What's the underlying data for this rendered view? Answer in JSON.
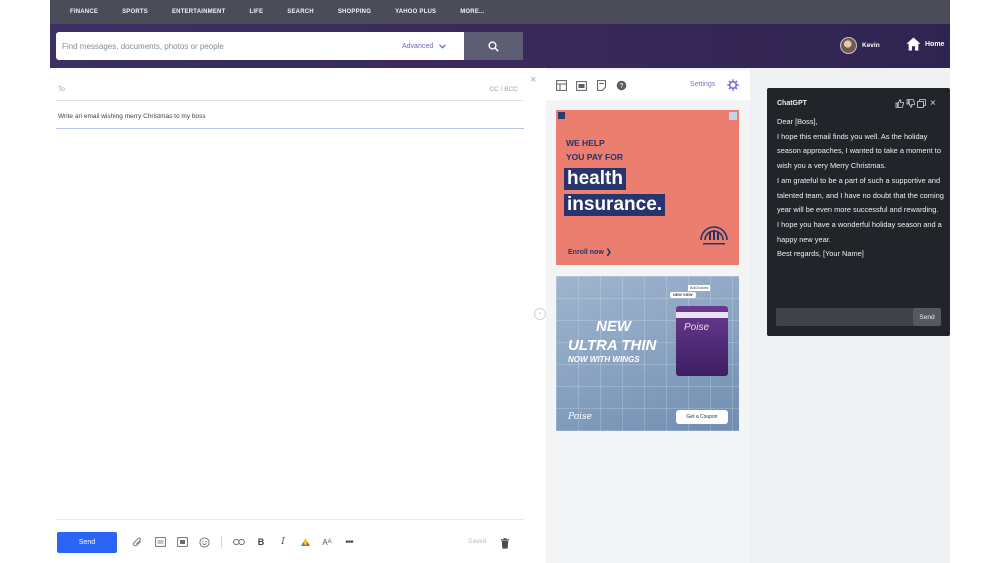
{
  "topnav": {
    "items": [
      "FINANCE",
      "SPORTS",
      "ENTERTAINMENT",
      "LIFE",
      "SEARCH",
      "SHOPPING",
      "YAHOO PLUS",
      "MORE..."
    ]
  },
  "header": {
    "search_placeholder": "Find messages, documents, photos or people",
    "advanced_label": "Advanced",
    "profile_name": "Kevin",
    "home_label": "Home"
  },
  "compose": {
    "to_label": "To",
    "cc_bcc_label": "CC / BCC",
    "subject": "Write an email wishing merry Christmas to my boss",
    "send_label": "Send",
    "saved_label": "Saved"
  },
  "right_panel": {
    "settings_label": "Settings"
  },
  "ad1": {
    "line1": "WE HELP",
    "line2": "YOU PAY FOR",
    "big1": "health",
    "big2": "insurance.",
    "cta": "Enroll now ❯"
  },
  "ad2": {
    "new_badge": "NEW VIEW",
    "adchoices": "AdChoices",
    "headline1": "NEW",
    "headline2": "ULTRA THIN",
    "headline3": "NOW WITH WINGS",
    "pack_brand": "Poise",
    "brand_name": "Poise",
    "coupon_label": "Get a Coupon"
  },
  "chat": {
    "title": "ChatGPT",
    "lines": [
      "Dear [Boss],",
      "I hope this email finds you well. As the holiday season approaches, I wanted to take a moment to wish you a very Merry Christmas.",
      "I am grateful to be a part of such a supportive and talented team, and I have no doubt that the coming year will be even more successful and rewarding.",
      "I hope you have a wonderful holiday season and a happy new year.",
      "Best regards, [Your Name]"
    ],
    "send_label": "Send"
  }
}
